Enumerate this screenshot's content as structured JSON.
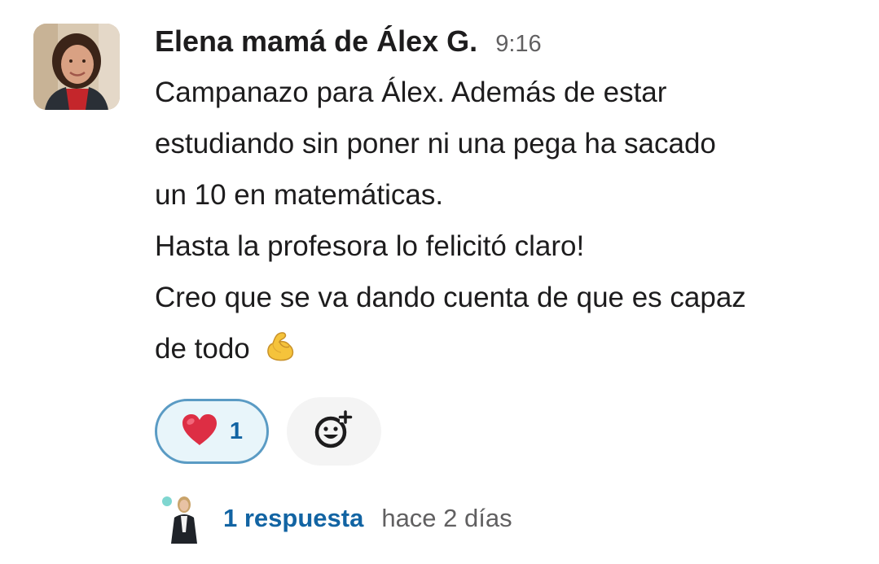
{
  "message": {
    "author": "Elena mamá de Álex G.",
    "time": "9:16",
    "lines": [
      "Campanazo para Álex. Además de estar",
      "estudiando sin poner ni una pega ha sacado",
      "un 10 en matemáticas.",
      "Hasta la profesora lo felicitó claro!",
      "Creo que se va dando cuenta de que es capaz",
      "de todo"
    ],
    "trailing_emoji": "flexed-biceps-emoji"
  },
  "reactions": [
    {
      "emoji": "red-heart-emoji",
      "count": "1"
    }
  ],
  "add_reaction": {
    "icon": "add-reaction-icon"
  },
  "thread": {
    "replies_label": "1 respuesta",
    "last_reply": "hace 2 días"
  },
  "colors": {
    "text": "#1d1c1d",
    "muted": "#616061",
    "link": "#1264a3",
    "reaction_border": "#5a9bc4",
    "reaction_bg": "#e8f5fa",
    "add_reaction_bg": "#f4f4f4"
  }
}
